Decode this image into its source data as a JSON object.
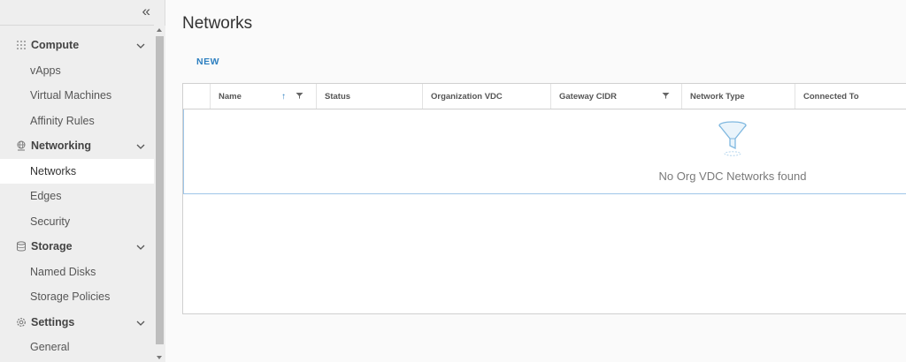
{
  "sidebar": {
    "collapse_label": "«",
    "groups": [
      {
        "label": "Compute",
        "icon": "grid-icon",
        "items": [
          {
            "label": "vApps"
          },
          {
            "label": "Virtual Machines"
          },
          {
            "label": "Affinity Rules"
          }
        ]
      },
      {
        "label": "Networking",
        "icon": "network-icon",
        "items": [
          {
            "label": "Networks",
            "active": true
          },
          {
            "label": "Edges"
          },
          {
            "label": "Security"
          }
        ]
      },
      {
        "label": "Storage",
        "icon": "database-icon",
        "items": [
          {
            "label": "Named Disks"
          },
          {
            "label": "Storage Policies"
          }
        ]
      },
      {
        "label": "Settings",
        "icon": "gear-icon",
        "items": [
          {
            "label": "General"
          }
        ]
      }
    ]
  },
  "main": {
    "title": "Networks",
    "new_button": "NEW",
    "grid": {
      "columns": [
        "Name",
        "Status",
        "Organization VDC",
        "Gateway CIDR",
        "Network Type",
        "Connected To"
      ],
      "sort_indicator": "↑",
      "empty_message": "No Org VDC Networks found"
    }
  },
  "colors": {
    "accent": "#2d7fc0",
    "sidebar_bg": "#eeeeee",
    "active_item_bg": "#ffffff"
  }
}
